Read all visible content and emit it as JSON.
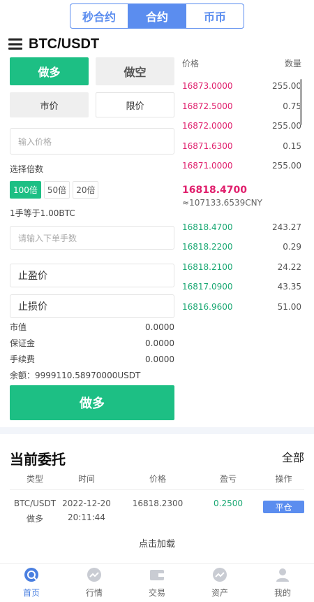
{
  "top_tabs": [
    {
      "label": "秒合约"
    },
    {
      "label": "合约"
    },
    {
      "label": "币币"
    }
  ],
  "header": {
    "title": "BTC/USDT",
    "icon": "menu-icon"
  },
  "trade": {
    "long_label": "做多",
    "short_label": "做空",
    "market_label": "市价",
    "limit_label": "限价",
    "price_placeholder": "输入价格",
    "leverage_label": "选择倍数",
    "leverages": [
      "100倍",
      "50倍",
      "20倍"
    ],
    "lot_note": "1手等于1.00BTC",
    "qty_placeholder": "请输入下单手数",
    "take_profit_placeholder": "止盈价",
    "stop_loss_placeholder": "止损价",
    "stats": [
      {
        "label": "市值",
        "value": "0.0000"
      },
      {
        "label": "保证金",
        "value": "0.0000"
      },
      {
        "label": "手续费",
        "value": "0.0000"
      }
    ],
    "balance": "余额：9999110.58970000USDT",
    "submit_label": "做多"
  },
  "order_book": {
    "price_header": "价格",
    "qty_header": "数量",
    "asks": [
      {
        "price": "16873.0000",
        "qty": "255.00"
      },
      {
        "price": "16872.5000",
        "qty": "0.75"
      },
      {
        "price": "16872.0000",
        "qty": "255.00"
      },
      {
        "price": "16871.6300",
        "qty": "0.15"
      },
      {
        "price": "16871.0000",
        "qty": "255.00"
      }
    ],
    "last_price": "16818.4700",
    "last_cny": "≈107133.6539CNY",
    "bids": [
      {
        "price": "16818.4700",
        "qty": "243.27"
      },
      {
        "price": "16818.2200",
        "qty": "0.29"
      },
      {
        "price": "16818.2100",
        "qty": "24.22"
      },
      {
        "price": "16817.0900",
        "qty": "43.35"
      },
      {
        "price": "16816.9600",
        "qty": "51.00"
      }
    ],
    "colors": {
      "ask": "#e0206d",
      "bid": "#1aa873"
    }
  },
  "orders": {
    "title": "当前委托",
    "all_label": "全部",
    "headers": [
      "类型",
      "时间",
      "价格",
      "盈亏",
      "操作"
    ],
    "rows": [
      {
        "pair": "BTC/USDT",
        "side": "做多",
        "date": "2022-12-20",
        "time": "20:11:44",
        "price": "16818.2300",
        "pnl": "0.2500",
        "action": "平仓"
      }
    ],
    "load_more": "点击加载"
  },
  "nav": [
    {
      "label": "首页",
      "icon": "home-icon"
    },
    {
      "label": "行情",
      "icon": "market-icon"
    },
    {
      "label": "交易",
      "icon": "wallet-icon"
    },
    {
      "label": "资产",
      "icon": "assets-icon"
    },
    {
      "label": "我的",
      "icon": "user-icon"
    }
  ],
  "colors": {
    "accent": "#5b8def",
    "long": "#1dbf84",
    "nav_active": "#4a7fe0"
  }
}
